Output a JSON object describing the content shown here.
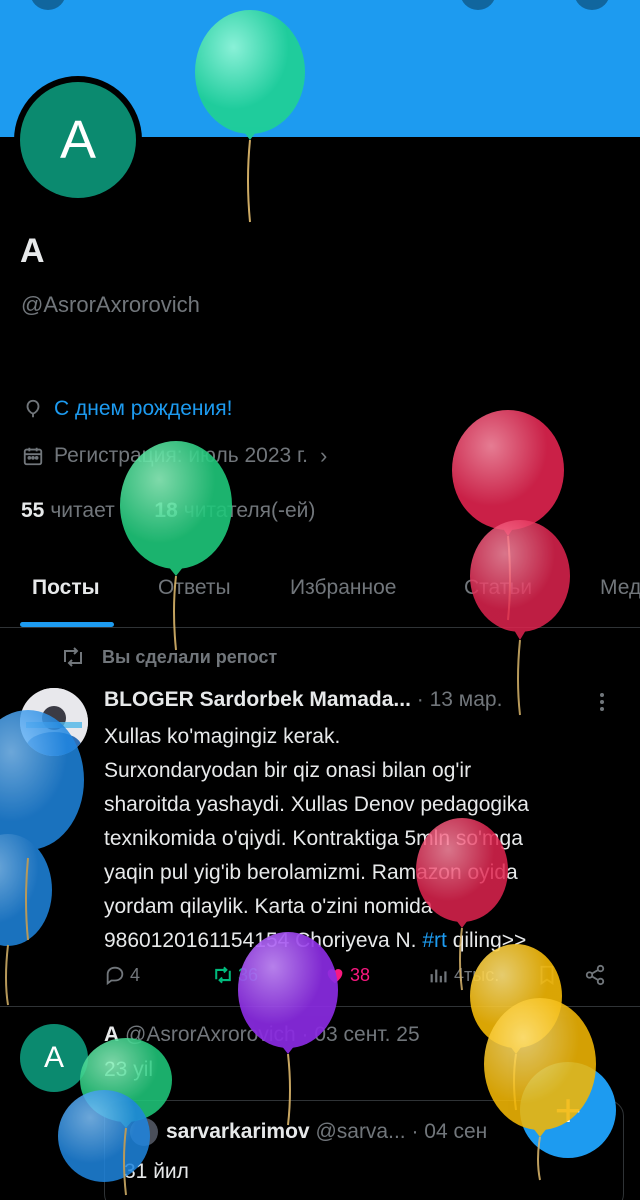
{
  "profile": {
    "avatar_letter": "A",
    "display_name": "A",
    "handle": "@AsrorAxrorovich",
    "birthday_text": "С днем рождения!",
    "registration_text": "Регистрация: июль 2023 г.",
    "following_count": "55",
    "following_label": "читает",
    "followers_count": "18",
    "followers_label": "читателя(-ей)"
  },
  "tabs": [
    {
      "label": "Посты",
      "active": true
    },
    {
      "label": "Ответы",
      "active": false
    },
    {
      "label": "Избранное",
      "active": false
    },
    {
      "label": "Статьи",
      "active": false
    },
    {
      "label": "Мед",
      "active": false
    }
  ],
  "feed": {
    "repost_label": "Вы сделали репост",
    "tweet1": {
      "author": "BLOGER Sardorbek Mamada...",
      "dot": "·",
      "date": "13 мар.",
      "lines": [
        "Xullas ko'magingiz kerak.",
        "Surxondaryodan bir qiz onasi bilan og'ir",
        "sharoitda yashaydi. Xullas Denov pedagogika",
        "texnikomida o'qiydi. Kontraktiga 5mln so'mga",
        "yaqin pul yig'ib berolamizmi. Ramazon oyida",
        "yordam qilaylik. Karta o'zini nomida"
      ],
      "last_line_prefix": "9860120161154154 Choriyeva N. ",
      "hashtag": "#rt",
      "last_line_suffix": " qiling>>",
      "replies": "4",
      "reposts": "36",
      "likes": "38",
      "views": "4тыс."
    },
    "tweet2": {
      "avatar_letter": "A",
      "author": "A",
      "rest": " @AsrorAxrorovich · 03 сент. 25",
      "text": "23 yil",
      "quote": {
        "author": "sarvarkarimov",
        "rest": " @sarva... · 04 сен",
        "text": "31 йил"
      }
    }
  },
  "fab_label": "+",
  "colors": {
    "accent": "#1d9bf0",
    "repost_green": "#00ba7c",
    "like_pink": "#f91880",
    "avatar_green": "#0b8a6f"
  }
}
